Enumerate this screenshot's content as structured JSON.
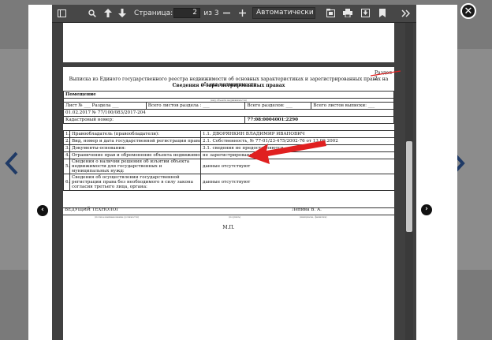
{
  "viewer": {
    "page_label": "Страница:",
    "page_current": "2",
    "page_total": "из 3",
    "zoom": "Автоматически"
  },
  "icons": [
    "sidebar-toggle-icon",
    "search-icon",
    "arrow-up-icon",
    "arrow-down-icon",
    "minus-icon",
    "plus-icon",
    "presentation-icon",
    "print-icon",
    "download-icon",
    "bookmark-icon",
    "tools-icon",
    "close-icon",
    "chevron-left-icon",
    "chevron-right-icon"
  ],
  "document": {
    "section_no": "Раздел 2",
    "title": "Выписка из Единого государственного реестра недвижимости об основных характеристиках и зарегистрированных правах на объект недвижимости",
    "subtitle": "Сведения о зарегистрированных правах",
    "object_label": "Помещение",
    "object_caption": "(вид объекта недвижимости)",
    "sheet_no": "Лист № ___ Раздела ___",
    "sheets_in_section": "Всего листов раздела : ___",
    "sections_total": "Всего разделов: ___",
    "sheets_total": "Всего листов выписки: ___",
    "date_no": "01.02.2017 № 77/100/083/2017-204",
    "cadastral_label": "Кадастровый номер:",
    "cadastral_value": "77:08:0004001:2290",
    "rows": [
      {
        "n": "1.",
        "label": "Правообладатель (правообладатели):",
        "code": "1.1.",
        "value": "ДВОРЯНКИН ВЛАДИМИР ИВАНОВИЧ"
      },
      {
        "n": "2.",
        "label": "Вид, номер и дата государственной регистрации права:",
        "code": "2.1.",
        "value": "Собственность, № 77-01/23-475/2002-76 от 13.09.2002"
      },
      {
        "n": "3.",
        "label": "Документы-основания:",
        "code": "3.1.",
        "value": "сведения не предоставляются"
      },
      {
        "n": "4.",
        "label": "Ограничение прав и обременение объекта недвижимости:",
        "code": "",
        "value": "не зарегистрировано"
      },
      {
        "n": "5.",
        "label": "Сведения о наличии решения об изъятии объекта недвижимости для государственных и муниципальных нужд:",
        "code": "",
        "value": "данные отсутствуют"
      },
      {
        "n": "6.",
        "label": "Сведения об осуществлении государственной регистрации права без необходимого в силу закона согласия третьего лица, органа:",
        "code": "",
        "value": "данные отсутствуют"
      }
    ],
    "signer_title": "ВЕДУЩИЙ ТЕХНОЛОГ",
    "signer_name": "Лепина В. А.",
    "caption_position": "(полное наименование должности)",
    "caption_signature": "(подпись)",
    "caption_initials": "(инициалы, фамилия)",
    "stamp": "М.П."
  },
  "colors": {
    "toolbar": "#474747",
    "viewer_bg": "#404040",
    "annotation_red": "#e02020",
    "nav_arrow": "#1f3a66"
  }
}
